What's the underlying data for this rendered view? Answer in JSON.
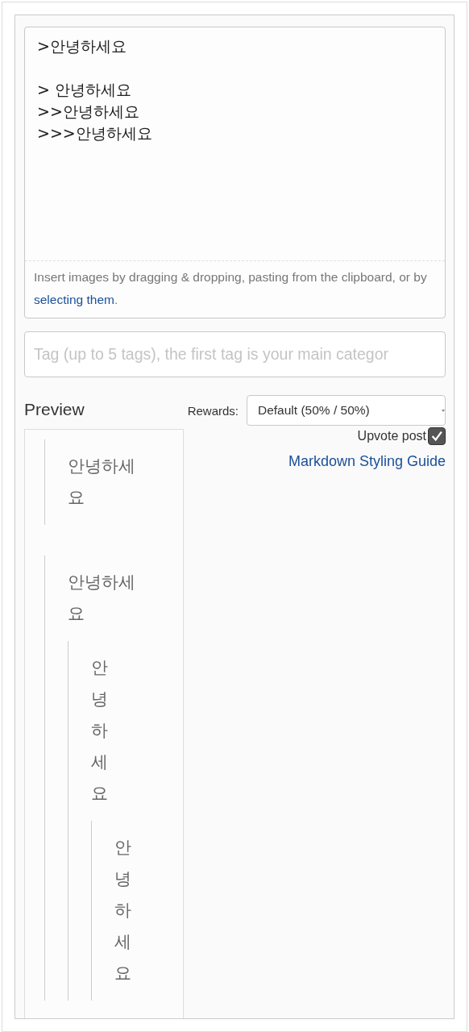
{
  "editor": {
    "value": ">안녕하세요\n\n> 안녕하세요\n>>안녕하세요\n>>>안녕하세요",
    "hint": "Insert images by dragging & dropping, pasting from the clipboard, or by ",
    "hint_link": "selecting them",
    "hint_end": "."
  },
  "tag_field": {
    "placeholder": "Tag (up to 5 tags), the first tag is your main categor"
  },
  "preview": {
    "title": "Preview",
    "blocks": [
      {
        "text": "안녕하세요"
      },
      {
        "text": "안녕하세요",
        "children": [
          {
            "text": "안녕하세요",
            "children": [
              {
                "text": "안녕하세요"
              }
            ]
          }
        ]
      }
    ]
  },
  "rewards": {
    "label": "Rewards:",
    "value": "Default (50% / 50%)"
  },
  "upvote": {
    "label": "Upvote post",
    "checked": true
  },
  "guide_link": "Markdown Styling Guide"
}
